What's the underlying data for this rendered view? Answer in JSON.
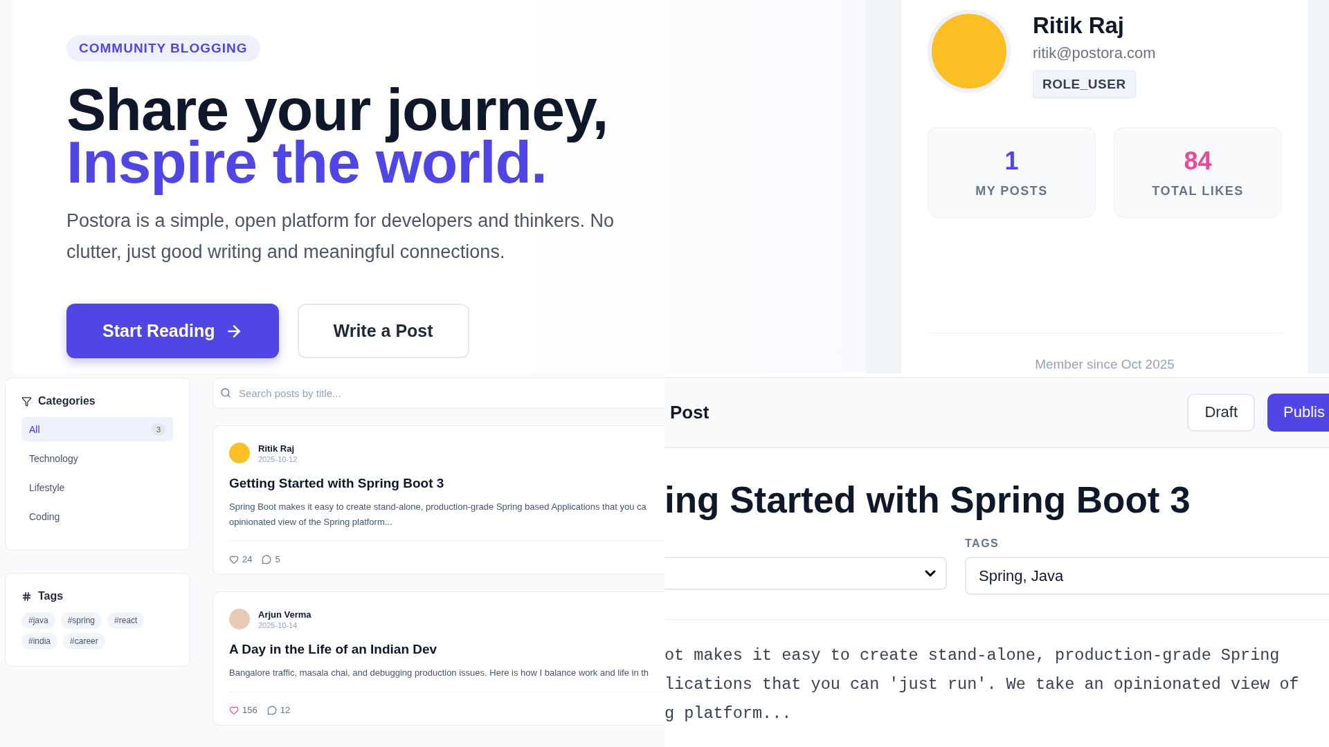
{
  "hero": {
    "badge": "COMMUNITY BLOGGING",
    "title_line_1": "Share your journey,",
    "title_line_2": "Inspire the world.",
    "description": "Postora is a simple, open platform for developers and thinkers. No clutter, just good writing and meaningful connections.",
    "buttons": [
      {
        "label": "Start Reading",
        "kind": "primary"
      },
      {
        "label": "Write a Post",
        "kind": "secondary"
      }
    ]
  },
  "profile": {
    "name": "Ritik Raj",
    "email": "ritik@postora.com",
    "role": "ROLE_USER",
    "stats": [
      {
        "value": "1",
        "label": "MY POSTS",
        "color": "#4f46e5"
      },
      {
        "value": "84",
        "label": "TOTAL LIKES",
        "color": "#ec4899"
      }
    ],
    "member_since": "Member since Oct 2025"
  },
  "sidebar": {
    "categories_title": "Categories",
    "categories": [
      {
        "label": "All",
        "count": "3",
        "selected": true
      },
      {
        "label": "Technology",
        "selected": false
      },
      {
        "label": "Lifestyle",
        "selected": false
      },
      {
        "label": "Coding",
        "selected": false
      }
    ],
    "tags_title": "Tags",
    "tags": [
      "#java",
      "#spring",
      "#react",
      "#india",
      "#career"
    ]
  },
  "search": {
    "placeholder": "Search posts by title..."
  },
  "posts": [
    {
      "author": "Ritik Raj",
      "date": "2025-10-12",
      "color": "#fbbf24",
      "title": "Getting Started with Spring Boot 3",
      "excerpt": "Spring Boot makes it easy to create stand-alone, production-grade Spring based Applications that you ca",
      "excerpt_2": "opinionated view of the Spring platform...",
      "likes": "24",
      "comments": "5",
      "liked": false
    },
    {
      "author": "Arjun Verma",
      "date": "2025-10-14",
      "color": "#e7c9b5",
      "title": "A Day in the Life of an Indian Dev",
      "excerpt": "Bangalore traffic, masala chai, and debugging production issues. Here is how I balance work and life in th",
      "likes": "156",
      "comments": "12",
      "liked": true
    }
  ],
  "editor": {
    "header_title": "Post",
    "buttons": [
      {
        "label": "Draft",
        "kind": "secondary"
      },
      {
        "label": "Publis",
        "kind": "primary"
      }
    ],
    "title": "ing Started with Spring Boot 3",
    "tags_label": "TAGS",
    "tags_value": "Spring, Java",
    "body": [
      "ot makes it easy to create stand-alone, production-grade Spring",
      "lications that you can 'just run'. We take an opinionated view of",
      "g platform..."
    ]
  }
}
